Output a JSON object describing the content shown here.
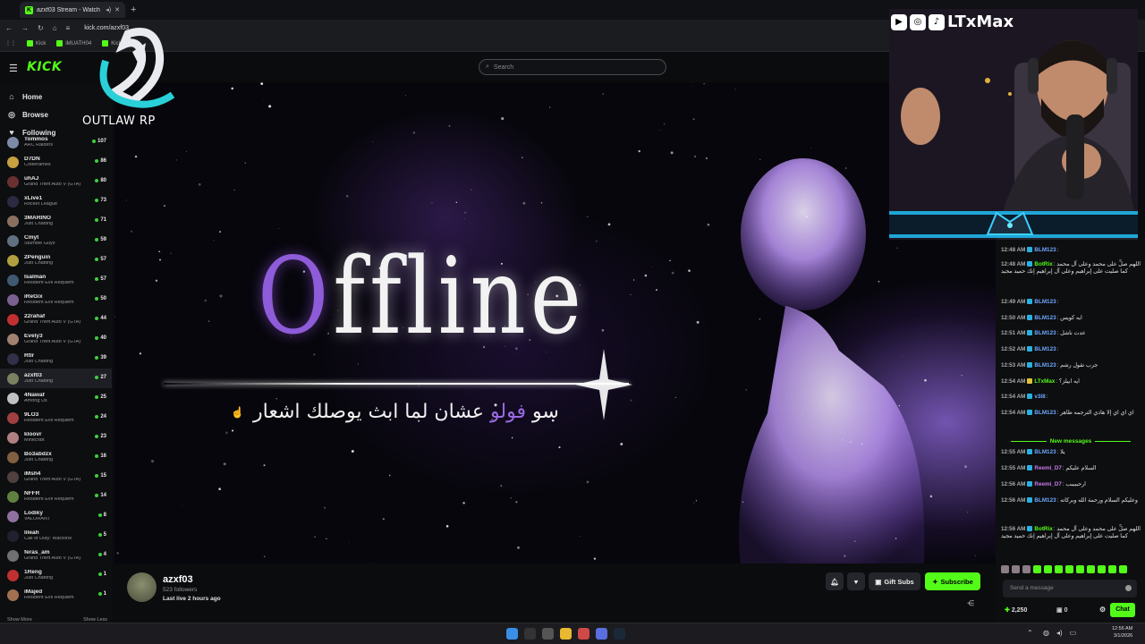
{
  "browser": {
    "tab_title": "azxf03 Stream - Watch Liv",
    "url": "kick.com/azxf03",
    "new_tab_label": "+",
    "bookmarks": [
      "Kick",
      "iMUATH04",
      "Kick"
    ]
  },
  "kick": {
    "logo": "KICK",
    "search_placeholder": "Search",
    "nav": [
      {
        "label": "Home",
        "icon": "home-icon"
      },
      {
        "label": "Browse",
        "icon": "compass-icon"
      },
      {
        "label": "Following",
        "icon": "heart-icon"
      }
    ],
    "channels": [
      {
        "name": "Tommos",
        "category": "ARC Raiders",
        "viewers": "107",
        "color": "#7d8aa8"
      },
      {
        "name": "D7DN",
        "category": "Codenames",
        "viewers": "86",
        "color": "#c8a040"
      },
      {
        "name": "uhAJ",
        "category": "Grand Theft Auto V (GTA)",
        "viewers": "80",
        "color": "#6a3030"
      },
      {
        "name": "xLive1",
        "category": "Rocket League",
        "viewers": "73",
        "color": "#2a2a40"
      },
      {
        "name": "3MARINO",
        "category": "Just Chatting",
        "viewers": "71",
        "color": "#8a7060"
      },
      {
        "name": "Cmyt",
        "category": "Stumble Guys",
        "viewers": "59",
        "color": "#607080"
      },
      {
        "name": "2Penguin",
        "category": "Just Chatting",
        "viewers": "57",
        "color": "#b0a040"
      },
      {
        "name": "Isalman",
        "category": "Resident Evil Requiem",
        "viewers": "57",
        "color": "#405870"
      },
      {
        "name": "iReGix",
        "category": "Resident Evil Requiem",
        "viewers": "50",
        "color": "#7a6090"
      },
      {
        "name": "22rahaf",
        "category": "Grand Theft Auto V (GTA)",
        "viewers": "44",
        "color": "#c03030"
      },
      {
        "name": "Evely3",
        "category": "Grand Theft Auto V (GTA)",
        "viewers": "40",
        "color": "#a08070"
      },
      {
        "name": "Rtlr",
        "category": "Just Chatting",
        "viewers": "39",
        "color": "#303048"
      },
      {
        "name": "azxf03",
        "category": "Just Chatting",
        "viewers": "27",
        "color": "#7a8060"
      },
      {
        "name": "4Nawaf",
        "category": "Among Us",
        "viewers": "25",
        "color": "#c0c0c0"
      },
      {
        "name": "9LO3",
        "category": "Resident Evil Requiem",
        "viewers": "24",
        "color": "#a04040"
      },
      {
        "name": "kloovr",
        "category": "Minecraft",
        "viewers": "23",
        "color": "#b08080"
      },
      {
        "name": "Bo3abdzx",
        "category": "Just Chatting",
        "viewers": "16",
        "color": "#806040"
      },
      {
        "name": "iMsh4",
        "category": "Grand Theft Auto V (GTA)",
        "viewers": "15",
        "color": "#504040"
      },
      {
        "name": "NFFR",
        "category": "Resident Evil Requiem",
        "viewers": "14",
        "color": "#608040"
      },
      {
        "name": "Lodiky",
        "category": "VALORANT",
        "viewers": "8",
        "color": "#9070a0"
      },
      {
        "name": "lileah",
        "category": "Call of Duty: Warzone",
        "viewers": "5",
        "color": "#202030"
      },
      {
        "name": "feras_am",
        "category": "Grand Theft Auto V (GTA)",
        "viewers": "4",
        "color": "#707070"
      },
      {
        "name": "1Reng",
        "category": "Just Chatting",
        "viewers": "1",
        "color": "#c03030"
      },
      {
        "name": "iMajed",
        "category": "Resident Evil Requiem",
        "viewers": "1",
        "color": "#a07050"
      }
    ],
    "show_more": "Show More",
    "show_less": "Show Less"
  },
  "overlay": {
    "server_logo_text": "OUTLAW RP",
    "social_handle": "LTxMax"
  },
  "banner": {
    "title_first": "O",
    "title_rest": "ffline",
    "arabic_prefix": "سو ",
    "arabic_highlight": "فولو",
    "arabic_rest": " عشان لما ابث يوصلك اشعار"
  },
  "channel": {
    "name": "azxf03",
    "followers": "523 followers",
    "last_live": "Last live 2 hours ago",
    "gift_label": "Gift Subs",
    "subscribe_label": "Subscribe"
  },
  "chat": {
    "messages": [
      {
        "time": "12:48 AM",
        "user": "BLM123",
        "color": "#6ea8ff",
        "text": "",
        "badge": "blue"
      },
      {
        "time": "12:48 AM",
        "user": "BotRix",
        "color": "#53fc18",
        "text": "اللهم صلِّ على محمد وعلى آل محمد كما صليت على إبراهيم وعلى آل إبراهيم إنك حميد مجيد",
        "badge": "blue"
      },
      {
        "time": "12:49 AM",
        "user": "BLM123",
        "color": "#6ea8ff",
        "text": "",
        "badge": "blue"
      },
      {
        "time": "12:50 AM",
        "user": "BLM123",
        "color": "#6ea8ff",
        "text": "ايه كويس",
        "badge": "blue"
      },
      {
        "time": "12:51 AM",
        "user": "BLM123",
        "color": "#6ea8ff",
        "text": "عدت ناشل",
        "badge": "blue"
      },
      {
        "time": "12:52 AM",
        "user": "BLM123",
        "color": "#6ea8ff",
        "text": "",
        "badge": "blue"
      },
      {
        "time": "12:53 AM",
        "user": "BLM123",
        "color": "#6ea8ff",
        "text": "جرب تقول رشم",
        "badge": "blue"
      },
      {
        "time": "12:54 AM",
        "user": "LTxMax",
        "color": "#53fc18",
        "text": "ايه ابيلز؟",
        "badge": "gold"
      },
      {
        "time": "12:54 AM",
        "user": "v3l8",
        "color": "#6ea8ff",
        "text": "",
        "badge": "blue"
      },
      {
        "time": "12:54 AM",
        "user": "BLM123",
        "color": "#6ea8ff",
        "text": "اي اي اي إلا هادي الترجمه طاهر",
        "badge": "blue"
      },
      {
        "time": "12:55 AM",
        "user": "BLM123",
        "color": "#6ea8ff",
        "text": "يلا",
        "badge": "blue"
      },
      {
        "time": "12:55 AM",
        "user": "Reemi_D7",
        "color": "#c879f0",
        "text": "السلام عليكم",
        "badge": "blue"
      },
      {
        "time": "12:56 AM",
        "user": "Reemi_D7",
        "color": "#c879f0",
        "text": "ارحببببب",
        "badge": "blue"
      },
      {
        "time": "12:56 AM",
        "user": "BLM123",
        "color": "#6ea8ff",
        "text": "وعليكم السلام ورحمة الله وبركاته",
        "badge": "blue"
      },
      {
        "time": "12:56 AM",
        "user": "BotRix",
        "color": "#53fc18",
        "text": "اللهم صلِّ على محمد وعلى آل محمد كما صليت على إبراهيم وعلى آل إبراهيم إنك حميد مجيد",
        "badge": "blue"
      }
    ],
    "new_messages": "New messages",
    "input_placeholder": "Send a message",
    "points": "2,250",
    "gift_count": "0",
    "chat_button": "Chat"
  },
  "taskbar": {
    "time": "12:56 AM",
    "date": "3/1/2026"
  }
}
